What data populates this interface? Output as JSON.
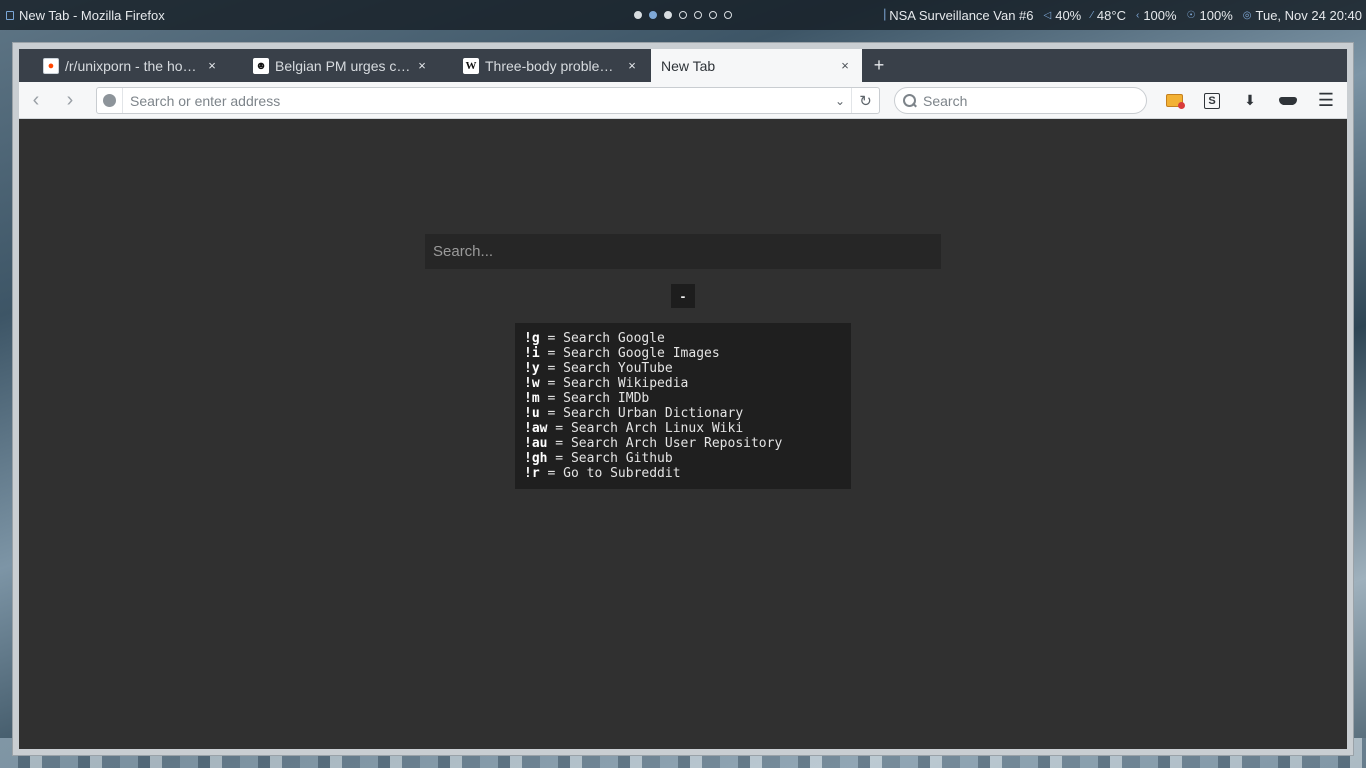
{
  "panel": {
    "window_title": "New Tab - Mozilla Firefox",
    "workspaces": [
      "filled",
      "active",
      "filled",
      "empty",
      "empty",
      "empty",
      "empty"
    ],
    "tray": [
      {
        "icon": "wifi-icon",
        "glyph": "▕",
        "text": "NSA Surveillance Van #6"
      },
      {
        "icon": "volume-icon",
        "glyph": "◁",
        "text": "40%"
      },
      {
        "icon": "temperature-icon",
        "glyph": "⁄",
        "text": "48°C"
      },
      {
        "icon": "battery-icon",
        "glyph": "‹",
        "text": "100%"
      },
      {
        "icon": "brightness-icon",
        "glyph": "☉",
        "text": "100%"
      },
      {
        "icon": "clock-icon",
        "glyph": "◎",
        "text": "Tue, Nov 24  20:40"
      }
    ]
  },
  "tabs": [
    {
      "title": "/r/unixporn - the home for *NIX customisation!",
      "favicon": "reddit-icon",
      "active": false
    },
    {
      "title": "Belgian PM urges calm, lockdown continues",
      "favicon": "person-icon",
      "active": false
    },
    {
      "title": "Three-body problem - Wikipedia",
      "favicon": "wikipedia-icon",
      "active": false
    },
    {
      "title": "New Tab",
      "favicon": "",
      "active": true
    }
  ],
  "toolbar": {
    "back_label": "‹",
    "forward_label": "›",
    "url_placeholder": "Search or enter address",
    "search_placeholder": "Search",
    "download_glyph": "⬇",
    "menu_glyph": "☰",
    "stylish_letter": "S",
    "reload_glyph": "↻",
    "dropdown_glyph": "⌄",
    "new_tab_glyph": "+",
    "close_glyph": "×"
  },
  "page": {
    "search_placeholder": "Search...",
    "toggle_label": "-",
    "shortcuts": [
      {
        "key": "!g",
        "desc": " = Search Google"
      },
      {
        "key": "!i",
        "desc": " = Search Google Images"
      },
      {
        "key": "!y",
        "desc": " = Search YouTube"
      },
      {
        "key": "!w",
        "desc": " = Search Wikipedia"
      },
      {
        "key": "!m",
        "desc": " = Search IMDb"
      },
      {
        "key": "!u",
        "desc": " = Search Urban Dictionary"
      },
      {
        "key": "!aw",
        "desc": " = Search Arch Linux Wiki"
      },
      {
        "key": "!au",
        "desc": " = Search Arch User Repository"
      },
      {
        "key": "!gh",
        "desc": " = Search Github"
      },
      {
        "key": "!r",
        "desc": " = Go to Subreddit"
      }
    ]
  },
  "colors": {
    "page_background": "#303030",
    "help_background": "#1f1f1f",
    "tab_strip": "#394049",
    "active_workspace": "#7fa9d8"
  }
}
